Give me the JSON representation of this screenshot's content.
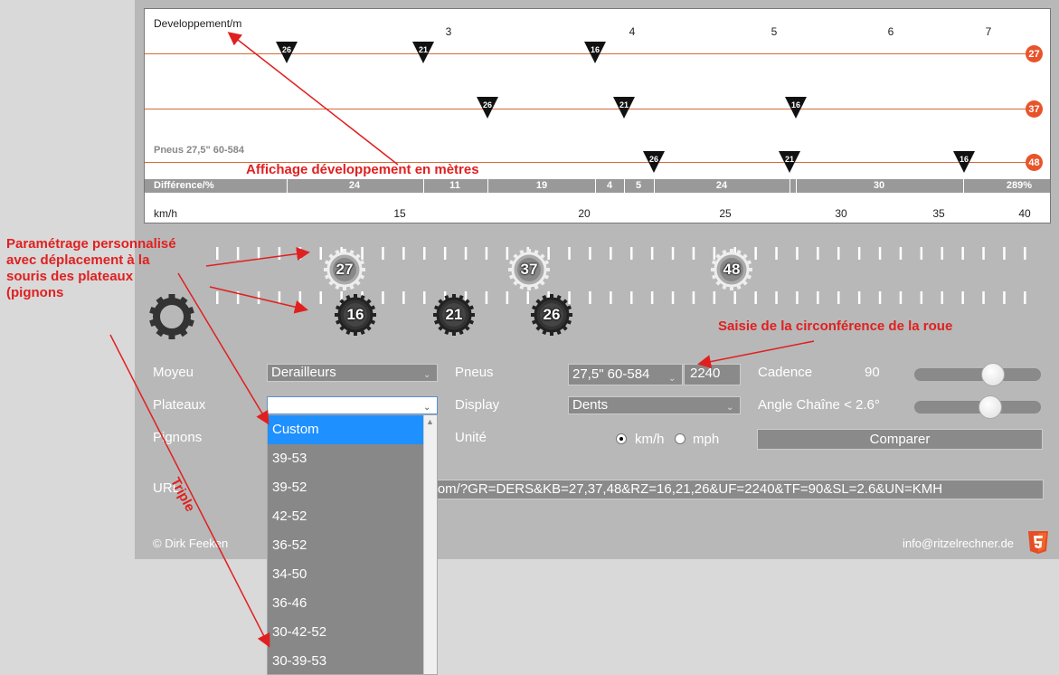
{
  "chart": {
    "dev_label": "Developpement/m",
    "top_ticks": [
      "3",
      "4",
      "5",
      "6",
      "7"
    ],
    "pneus_label": "Pneus 27,5\" 60-584",
    "diff_label": "Différence/%",
    "diff_values": [
      "24",
      "11",
      "19",
      "4",
      "5",
      "24",
      "30",
      "289%"
    ],
    "kmh_label": "km/h",
    "bottom_ticks": [
      "15",
      "20",
      "25",
      "30",
      "35",
      "40"
    ],
    "rows": [
      {
        "plateau": "27",
        "markers": [
          "26",
          "21",
          "16"
        ]
      },
      {
        "plateau": "37",
        "markers": [
          "26",
          "21",
          "16"
        ]
      },
      {
        "plateau": "48",
        "markers": [
          "26",
          "21",
          "16"
        ]
      }
    ]
  },
  "gears": {
    "plateaux": [
      "27",
      "37",
      "48"
    ],
    "pignons": [
      "16",
      "21",
      "26"
    ]
  },
  "form": {
    "moyeu_label": "Moyeu",
    "moyeu_value": "Derailleurs",
    "plateaux_label": "Plateaux",
    "plateaux_value": "",
    "pignons_label": "Pignons",
    "url_label": "URL",
    "url_value": "r.com/?GR=DERS&KB=27,37,48&RZ=16,21,26&UF=2240&TF=90&SL=2.6&UN=KMH",
    "pneus_label": "Pneus",
    "pneus_value": "27,5\" 60-584",
    "circumference": "2240",
    "display_label": "Display",
    "display_value": "Dents",
    "unite_label": "Unité",
    "unit_kmh": "km/h",
    "unit_mph": "mph",
    "cadence_label": "Cadence",
    "cadence_value": "90",
    "cadence_level": 0.62,
    "angle_label": "Angle Chaîne < 2.6°",
    "angle_level": 0.6,
    "compare_label": "Comparer"
  },
  "dropdown": {
    "options": [
      "Custom",
      "39-53",
      "39-52",
      "42-52",
      "36-52",
      "34-50",
      "36-46",
      "30-42-52",
      "30-39-53"
    ],
    "selected": "Custom"
  },
  "footer": {
    "copyright": "© Dirk Feeken",
    "email": "info@ritzelrechner.de"
  },
  "annotations": {
    "dev": "Affichage développement en mètres",
    "param": "Paramétrage personnalisé avec déplacement à la souris des plateaux (pignons",
    "saisie": "Saisie de la circonférence de la roue",
    "triple": "Triple"
  },
  "colors": {
    "accent": "#e8542a",
    "annotation": "#e02020",
    "selection": "#1e90ff"
  }
}
